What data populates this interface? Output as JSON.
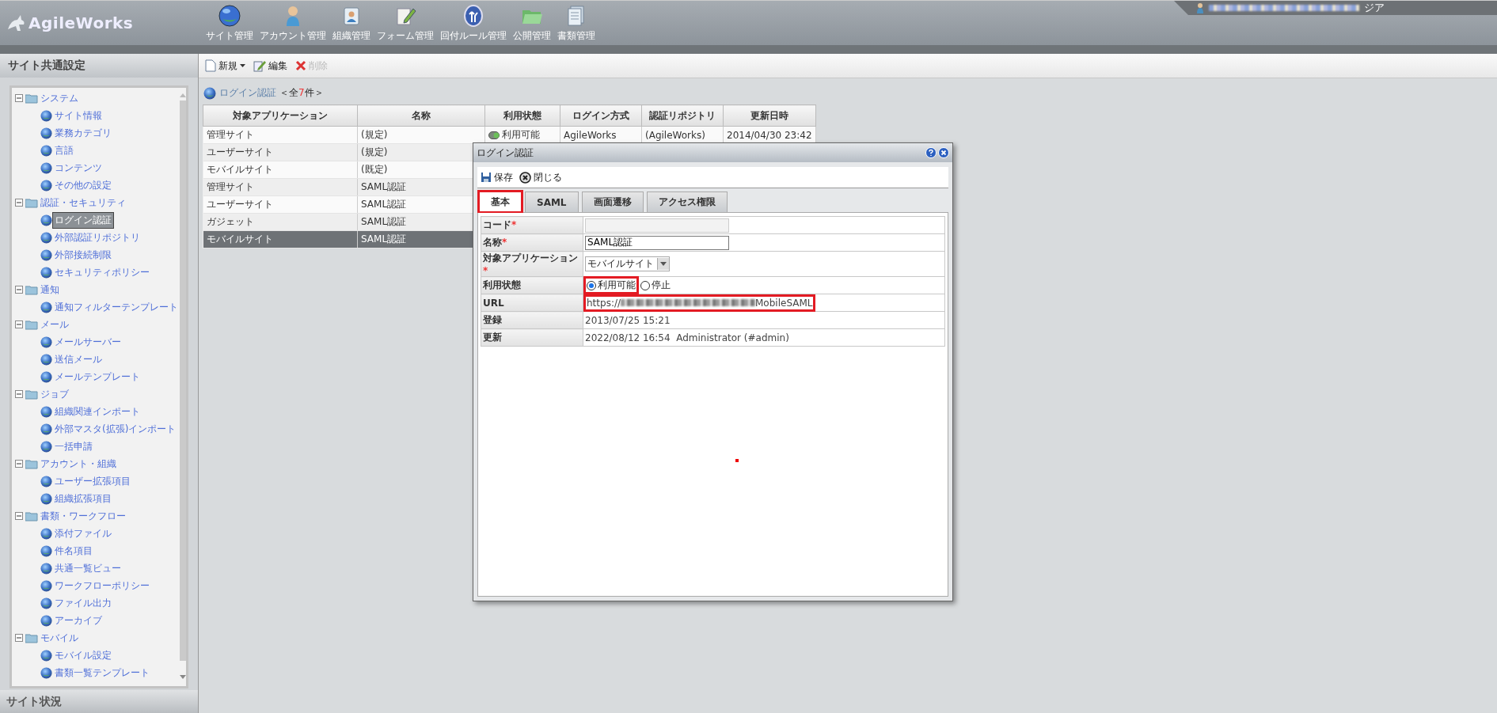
{
  "header": {
    "logo": "AgileWorks",
    "nav": [
      {
        "label": "サイト管理"
      },
      {
        "label": "アカウント管理"
      },
      {
        "label": "組織管理"
      },
      {
        "label": "フォーム管理"
      },
      {
        "label": "回付ルール管理"
      },
      {
        "label": "公開管理"
      },
      {
        "label": "書類管理"
      }
    ],
    "user_cut": "ジア"
  },
  "sidebar": {
    "title": "サイト共通設定",
    "tree": [
      {
        "label": "システム",
        "expanded": true,
        "children": [
          {
            "label": "サイト情報",
            "selected": false
          },
          {
            "label": "業務カテゴリ",
            "selected": false
          },
          {
            "label": "言語",
            "selected": false
          },
          {
            "label": "コンテンツ",
            "selected": false
          },
          {
            "label": "その他の設定",
            "selected": false
          }
        ]
      },
      {
        "label": "認証・セキュリティ",
        "expanded": true,
        "children": [
          {
            "label": "ログイン認証",
            "selected": true
          },
          {
            "label": "外部認証リポジトリ",
            "selected": false
          },
          {
            "label": "外部接続制限",
            "selected": false
          },
          {
            "label": "セキュリティポリシー",
            "selected": false
          }
        ]
      },
      {
        "label": "通知",
        "expanded": true,
        "children": [
          {
            "label": "通知フィルターテンプレート",
            "selected": false
          }
        ]
      },
      {
        "label": "メール",
        "expanded": true,
        "children": [
          {
            "label": "メールサーバー",
            "selected": false
          },
          {
            "label": "送信メール",
            "selected": false
          },
          {
            "label": "メールテンプレート",
            "selected": false
          }
        ]
      },
      {
        "label": "ジョブ",
        "expanded": true,
        "children": [
          {
            "label": "組織関連インポート",
            "selected": false
          },
          {
            "label": "外部マスタ(拡張)インポート",
            "selected": false
          },
          {
            "label": "一括申請",
            "selected": false
          }
        ]
      },
      {
        "label": "アカウント・組織",
        "expanded": true,
        "children": [
          {
            "label": "ユーザー拡張項目",
            "selected": false
          },
          {
            "label": "組織拡張項目",
            "selected": false
          }
        ]
      },
      {
        "label": "書類・ワークフロー",
        "expanded": true,
        "children": [
          {
            "label": "添付ファイル",
            "selected": false
          },
          {
            "label": "件名項目",
            "selected": false
          },
          {
            "label": "共通一覧ビュー",
            "selected": false
          },
          {
            "label": "ワークフローポリシー",
            "selected": false
          },
          {
            "label": "ファイル出力",
            "selected": false
          },
          {
            "label": "アーカイブ",
            "selected": false
          }
        ]
      },
      {
        "label": "モバイル",
        "expanded": true,
        "children": [
          {
            "label": "モバイル設定",
            "selected": false
          },
          {
            "label": "書類一覧テンプレート",
            "selected": false
          }
        ]
      }
    ],
    "footer": "サイト状況"
  },
  "toolbar": [
    {
      "label": "新規",
      "menu": true,
      "disabled": false
    },
    {
      "label": "編集",
      "menu": false,
      "disabled": false
    },
    {
      "label": "削除",
      "menu": false,
      "disabled": true
    }
  ],
  "breadcrumb": {
    "title": "ログイン認証",
    "count_prefix": "＜全",
    "count": "7",
    "count_suffix": "件＞"
  },
  "table": {
    "columns": [
      "対象アプリケーション",
      "名称",
      "利用状態",
      "ログイン方式",
      "認証リポジトリ",
      "更新日時"
    ],
    "rows": [
      {
        "cells": [
          "管理サイト",
          "(規定)",
          "利用可能",
          "AgileWorks",
          "(AgileWorks)",
          "2014/04/30 23:42"
        ],
        "selected": false
      },
      {
        "cells": [
          "ユーザーサイト",
          "(規定)"
        ],
        "selected": false
      },
      {
        "cells": [
          "モバイルサイト",
          "(既定)"
        ],
        "selected": false
      },
      {
        "cells": [
          "管理サイト",
          "SAML認証"
        ],
        "selected": false
      },
      {
        "cells": [
          "ユーザーサイト",
          "SAML認証"
        ],
        "selected": false
      },
      {
        "cells": [
          "ガジェット",
          "SAML認証"
        ],
        "selected": false
      },
      {
        "cells": [
          "モバイルサイト",
          "SAML認証"
        ],
        "selected": true
      }
    ]
  },
  "dialog": {
    "title": "ログイン認証",
    "toolbar": [
      {
        "label": "保存"
      },
      {
        "label": "閉じる"
      }
    ],
    "tabs": [
      {
        "label": "基本",
        "selected": true,
        "highlighted": true
      },
      {
        "label": "SAML",
        "selected": false,
        "highlighted": false
      },
      {
        "label": "画面遷移",
        "selected": false,
        "highlighted": false
      },
      {
        "label": "アクセス権限",
        "selected": false,
        "highlighted": false
      }
    ],
    "fields": [
      {
        "kind": "input",
        "label": "コード",
        "required_mark": "*",
        "disabled": true
      },
      {
        "kind": "input",
        "label": "名称",
        "required_mark": "*",
        "value": "SAML認証",
        "disabled": false
      },
      {
        "kind": "select",
        "label": "対象アプリケーション",
        "required_mark": "*",
        "value": "モバイルサイト"
      },
      {
        "kind": "radio",
        "label": "利用状態",
        "options": [
          {
            "label": "利用可能",
            "selected": true,
            "highlighted": true
          },
          {
            "label": "停止",
            "selected": false,
            "highlighted": false
          }
        ]
      },
      {
        "kind": "url",
        "label": "URL",
        "prefix": "https://",
        "suffix": "MobileSAML",
        "highlighted": true
      },
      {
        "kind": "text",
        "label": "登録",
        "value": "2013/07/25 15:21"
      },
      {
        "kind": "text",
        "label": "更新",
        "value": "2022/08/12 16:54  Administrator (#admin)"
      }
    ]
  }
}
